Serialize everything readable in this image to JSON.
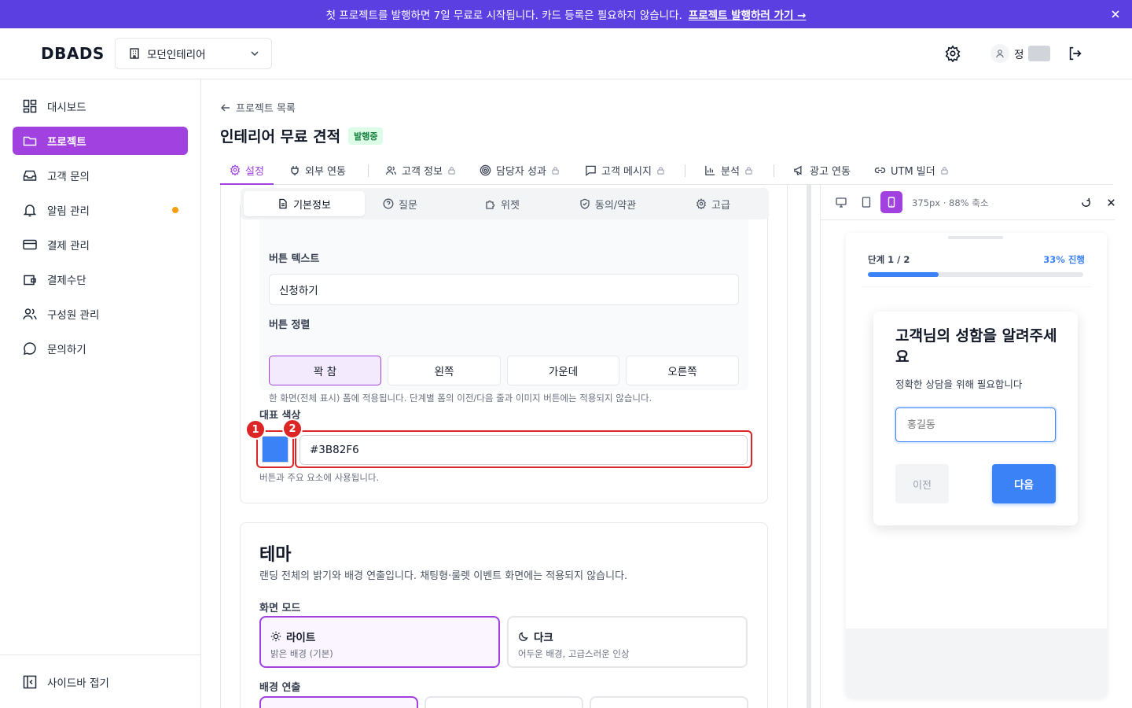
{
  "banner": {
    "text": "첫 프로젝트를 발행하면 7일 무료로 시작됩니다. 카드 등록은 필요하지 않습니다.",
    "link": "프로젝트 발행하러 가기 →"
  },
  "header": {
    "logo": "DBADS",
    "workspace": "모던인테리어",
    "user_name": "정"
  },
  "sidebar": {
    "items": [
      {
        "label": "대시보드",
        "icon": "dashboard-icon"
      },
      {
        "label": "프로젝트",
        "icon": "folder-icon",
        "active": true
      },
      {
        "label": "고객 문의",
        "icon": "inbox-icon"
      },
      {
        "label": "알림 관리",
        "icon": "bell-icon",
        "dot": true
      },
      {
        "label": "결제 관리",
        "icon": "credit-card-icon"
      },
      {
        "label": "결제수단",
        "icon": "wallet-icon"
      },
      {
        "label": "구성원 관리",
        "icon": "users-icon"
      },
      {
        "label": "문의하기",
        "icon": "chat-icon"
      }
    ],
    "collapse": "사이드바 접기"
  },
  "page": {
    "back": "프로젝트 목록",
    "title": "인테리어 무료 견적",
    "status": "발행중"
  },
  "tabs": [
    "설정",
    "외부 연동",
    "고객 정보",
    "담당자 성과",
    "고객 메시지",
    "분석",
    "광고 연동",
    "UTM 빌더"
  ],
  "subtabs": [
    "기본정보",
    "질문",
    "위젯",
    "동의/약관",
    "고급"
  ],
  "form": {
    "button_text_label": "버튼 텍스트",
    "button_text_value": "신청하기",
    "button_align_label": "버튼 정렬",
    "align_options": [
      "꽉 참",
      "왼쪽",
      "가운데",
      "오른쪽"
    ],
    "align_hint": "한 화면(전체 표시) 폼에 적용됩니다. 단계별 폼의 이전/다음 줄과 이미지 버튼에는 적용되지 않습니다.",
    "color_label": "대표 색상",
    "color_value": "#3B82F6",
    "color_hint": "버튼과 주요 요소에 사용됩니다.",
    "callout_1": "1",
    "callout_2": "2"
  },
  "theme": {
    "title": "테마",
    "desc": "랜딩 전체의 밝기와 배경 연출입니다. 채팅형·룰렛 이벤트 화면에는 적용되지 않습니다.",
    "mode_label": "화면 모드",
    "light_title": "라이트",
    "light_desc": "밝은 배경 (기본)",
    "dark_title": "다크",
    "dark_desc": "어두운 배경, 고급스러운 인상",
    "bg_label": "배경 연출"
  },
  "preview": {
    "size_info": "375px · 88% 축소",
    "step": "단계 1 / 2",
    "progress_text": "33% 진행",
    "progress": 0.33,
    "question": "고객님의 성함을 알려주세요",
    "sub": "정확한 상담을 위해 필요합니다",
    "placeholder": "홍길동",
    "prev": "이전",
    "next": "다음"
  },
  "colors": {
    "accent": "#a041e0",
    "brand": "#3B82F6",
    "banner": "#5b3fe0",
    "callout": "#dc2626"
  }
}
